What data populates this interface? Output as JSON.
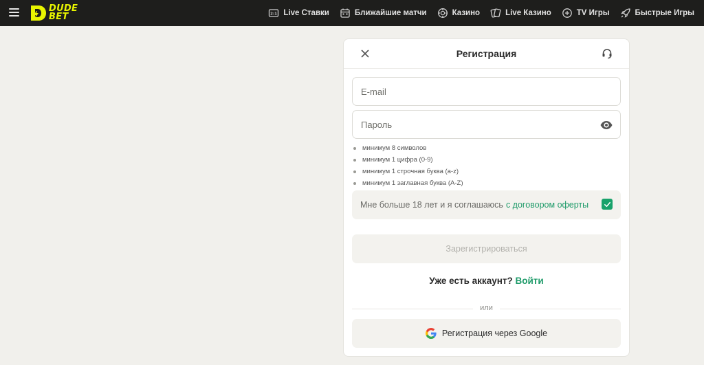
{
  "brand": {
    "logo_line1": "DUDE",
    "logo_line2": "BET",
    "accent": "#e8f500"
  },
  "nav": [
    {
      "label": "Live Ставки",
      "icon": "live-tv-icon"
    },
    {
      "label": "Ближайшие матчи",
      "icon": "calendar-icon"
    },
    {
      "label": "Казино",
      "icon": "casino-chip-icon"
    },
    {
      "label": "Live Казино",
      "icon": "cards-icon"
    },
    {
      "label": "TV Игры",
      "icon": "tv-games-icon"
    },
    {
      "label": "Быстрые Игры",
      "icon": "rocket-icon"
    }
  ],
  "modal": {
    "title": "Регистрация",
    "email_placeholder": "E-mail",
    "password_placeholder": "Пароль",
    "password_rules": [
      "минимум 8 символов",
      "минимум 1 цифра (0-9)",
      "минимум 1 строчная буква (a-z)",
      "минимум 1 заглавная буква (A-Z)"
    ],
    "terms_text": "Мне больше 18 лет и я соглашаюсь",
    "terms_link": "с договором оферты",
    "terms_checked": true,
    "submit_label": "Зарегистрироваться",
    "have_account_text": "Уже есть аккаунт?",
    "login_link": "Войти",
    "or_label": "или",
    "google_label": "Регистрация через Google"
  },
  "colors": {
    "primary_green": "#1f9b6a",
    "topbar_bg": "#1e1e1c",
    "page_bg": "#f1f0ec"
  }
}
